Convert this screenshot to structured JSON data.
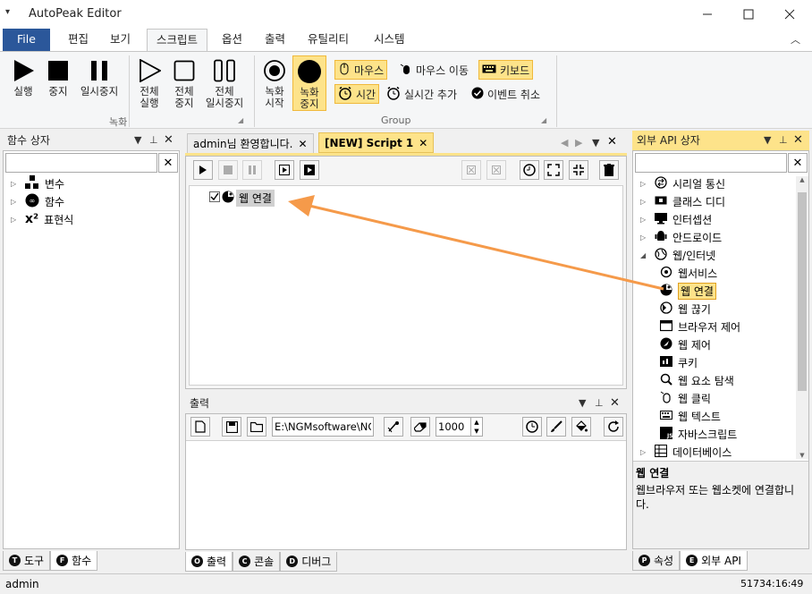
{
  "window": {
    "title": "AutoPeak Editor",
    "quick_access": "▾",
    "collapse_ribbon": "︿"
  },
  "menu": {
    "file": "File",
    "tabs": [
      "편집",
      "보기",
      "스크립트",
      "옵션",
      "출력",
      "유틸리티",
      "시스템"
    ],
    "active_tab": "스크립트"
  },
  "ribbon": {
    "record_group": {
      "label": "녹화",
      "buttons": [
        {
          "label": "실행",
          "icon": "play-icon"
        },
        {
          "label": "중지",
          "icon": "stop-icon"
        },
        {
          "label": "일시중지",
          "icon": "pause-icon"
        },
        {
          "label": "전체\n실행",
          "icon": "play-outline-icon"
        },
        {
          "label": "전체\n중지",
          "icon": "stop-outline-icon"
        },
        {
          "label": "전체\n일시중지",
          "icon": "pause-outline-icon"
        }
      ]
    },
    "group": {
      "label": "Group",
      "record_start": "녹화\n시작",
      "record_stop": "녹화\n중지",
      "mouse": "마우스",
      "mouse_move": "마우스 이동",
      "keyboard": "키보드",
      "time": "시간",
      "realtime_add": "실시간 추가",
      "event_cancel": "이벤트 취소"
    }
  },
  "left_panel": {
    "title": "함수 상자",
    "search_placeholder": "",
    "items": [
      {
        "label": "변수",
        "icon": "variable-icon"
      },
      {
        "label": "함수",
        "icon": "function-icon"
      },
      {
        "label": "표현식",
        "icon": "expression-icon"
      }
    ],
    "bottom_tabs": [
      {
        "key": "T",
        "label": "도구"
      },
      {
        "key": "F",
        "label": "함수"
      }
    ]
  },
  "editor": {
    "tabs": [
      {
        "label": "admin님 환영합니다."
      },
      {
        "label": "[NEW] Script 1"
      }
    ],
    "script_item": "웹 연결"
  },
  "output_panel": {
    "title": "출력",
    "path": "E:\\NGMsoftware\\NG",
    "number": "1000",
    "bottom_tabs": [
      {
        "key": "O",
        "label": "출력"
      },
      {
        "key": "C",
        "label": "콘솔"
      },
      {
        "key": "D",
        "label": "디버그"
      }
    ]
  },
  "right_panel": {
    "title": "외부 API 상자",
    "search_placeholder": "",
    "items": [
      {
        "label": "시리얼 통신",
        "level": 0,
        "expander": "▷"
      },
      {
        "label": "클래스 디디",
        "level": 0,
        "expander": "▷"
      },
      {
        "label": "인터셉션",
        "level": 0,
        "expander": "▷"
      },
      {
        "label": "안드로이드",
        "level": 0,
        "expander": "▷"
      },
      {
        "label": "웹/인터넷",
        "level": 0,
        "expander": "◢"
      },
      {
        "label": "웹서비스",
        "level": 1
      },
      {
        "label": "웹 연결",
        "level": 1,
        "selected": true
      },
      {
        "label": "웹 끊기",
        "level": 1
      },
      {
        "label": "브라우저 제어",
        "level": 1
      },
      {
        "label": "웹 제어",
        "level": 1
      },
      {
        "label": "쿠키",
        "level": 1
      },
      {
        "label": "웹 요소 탐색",
        "level": 1
      },
      {
        "label": "웹 클릭",
        "level": 1
      },
      {
        "label": "웹 텍스트",
        "level": 1
      },
      {
        "label": "자바스크립트",
        "level": 1
      },
      {
        "label": "데이터베이스",
        "level": 0,
        "expander": "▷"
      }
    ],
    "description_title": "웹 연결",
    "description_text": "웹브라우저 또는 웹소켓에 연결합니다.",
    "bottom_tabs": [
      {
        "key": "P",
        "label": "속성"
      },
      {
        "key": "E",
        "label": "외부 API"
      }
    ]
  },
  "status": {
    "user": "admin",
    "time": "51734:16:49"
  },
  "colors": {
    "accent": "#2b579a",
    "highlight": "#fde38a",
    "arrow": "#f59a4a",
    "selected_bg": "#fde38a"
  }
}
